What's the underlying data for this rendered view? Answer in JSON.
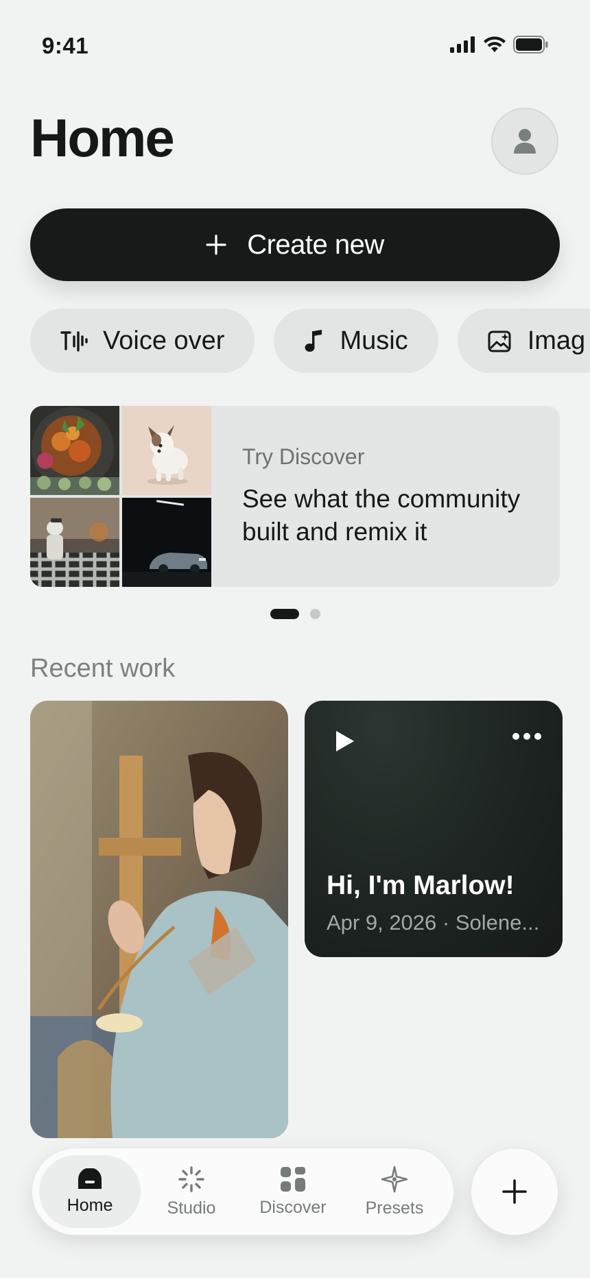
{
  "status_bar": {
    "time": "9:41"
  },
  "header": {
    "title": "Home"
  },
  "create": {
    "label": "Create new"
  },
  "chips": [
    {
      "label": "Voice over",
      "icon": "voice-waveform-icon"
    },
    {
      "label": "Music",
      "icon": "music-note-icon"
    },
    {
      "label": "Imag",
      "icon": "image-sparkle-icon"
    }
  ],
  "discover": {
    "subtitle": "Try Discover",
    "title": "See what the community built and remix it"
  },
  "recent": {
    "title": "Recent work",
    "voice_card": {
      "title": "Hi, I'm Marlow!",
      "meta": "Apr 9, 2026 · Solene..."
    }
  },
  "tabs": [
    {
      "label": "Home",
      "icon": "home-icon",
      "active": true
    },
    {
      "label": "Studio",
      "icon": "studio-sparkle-icon",
      "active": false
    },
    {
      "label": "Discover",
      "icon": "grid-icon",
      "active": false
    },
    {
      "label": "Presets",
      "icon": "presets-sparkle-icon",
      "active": false
    }
  ],
  "colors": {
    "background": "#f1f2f2",
    "primary": "#161b1a",
    "chip": "#e3e5e4",
    "card_dark": "#1d2421"
  }
}
